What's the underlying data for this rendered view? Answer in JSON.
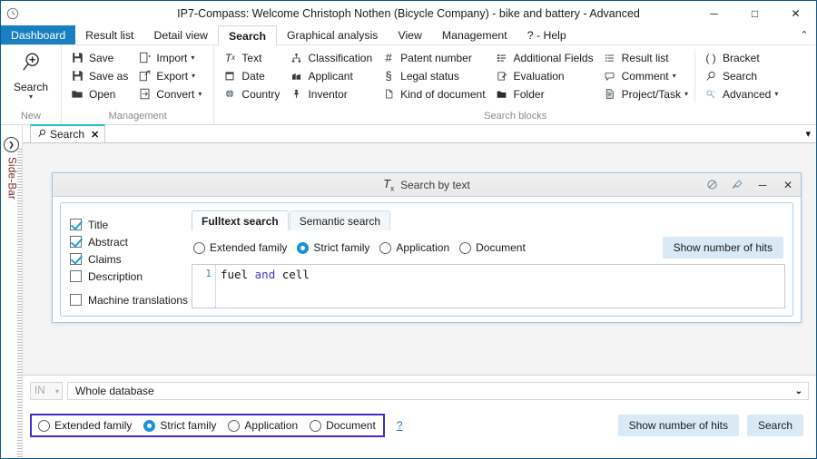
{
  "window": {
    "title": "IP7-Compass: Welcome Christoph Nothen (Bicycle Company) - bike and battery - Advanced",
    "app_icon": "clock-icon",
    "minimize": "─",
    "maximize": "□",
    "close": "✕"
  },
  "menubar": {
    "tabs": [
      {
        "label": "Dashboard",
        "state": "accent"
      },
      {
        "label": "Result list",
        "state": "normal"
      },
      {
        "label": "Detail view",
        "state": "normal"
      },
      {
        "label": "Search",
        "state": "active"
      },
      {
        "label": "Graphical analysis",
        "state": "normal"
      },
      {
        "label": "View",
        "state": "normal"
      },
      {
        "label": "Management",
        "state": "normal"
      },
      {
        "label": "? - Help",
        "state": "normal"
      }
    ],
    "collapse_icon": "chevron-up-icon",
    "collapse_glyph": "⌃"
  },
  "ribbon": {
    "groups": [
      {
        "label": "New",
        "big": {
          "label": "Search",
          "icon": "search-plus-icon",
          "glyph": "⊕",
          "caret": "▾"
        }
      },
      {
        "label": "Management",
        "columns": [
          [
            {
              "label": "Save",
              "icon": "save-icon",
              "glyph": "Ὃe",
              "caret": ""
            },
            {
              "label": "Save as",
              "icon": "save-as-icon",
              "glyph": "Ὃe",
              "caret": ""
            },
            {
              "label": "Open",
              "icon": "folder-open-icon",
              "glyph": "὜1",
              "caret": ""
            }
          ],
          [
            {
              "label": "Import",
              "icon": "import-icon",
              "glyph": "⇥",
              "caret": "▾"
            },
            {
              "label": "Export",
              "icon": "export-icon",
              "glyph": "⇤",
              "caret": "▾"
            },
            {
              "label": "Convert",
              "icon": "convert-icon",
              "glyph": "⭮",
              "caret": "▾"
            }
          ]
        ]
      },
      {
        "label": "Search blocks",
        "columns": [
          [
            {
              "label": "Text",
              "icon": "text-icon",
              "glyph": "Tₓ",
              "caret": ""
            },
            {
              "label": "Date",
              "icon": "calendar-icon",
              "glyph": "Ὄ5",
              "caret": ""
            },
            {
              "label": "Country",
              "icon": "globe-icon",
              "glyph": "ἱ0",
              "caret": ""
            }
          ],
          [
            {
              "label": "Classification",
              "icon": "hierarchy-icon",
              "glyph": "⑂",
              "caret": ""
            },
            {
              "label": "Applicant",
              "icon": "building-icon",
              "glyph": "Ἶ2",
              "caret": ""
            },
            {
              "label": "Inventor",
              "icon": "person-icon",
              "glyph": "὆4",
              "caret": ""
            }
          ],
          [
            {
              "label": "Patent number",
              "icon": "hash-icon",
              "glyph": "#",
              "caret": ""
            },
            {
              "label": "Legal status",
              "icon": "section-sign-icon",
              "glyph": "§",
              "caret": ""
            },
            {
              "label": "Kind of document",
              "icon": "document-icon",
              "glyph": "὜b",
              "caret": ""
            }
          ],
          [
            {
              "label": "Additional Fields",
              "icon": "fields-icon",
              "glyph": "☰",
              "caret": ""
            },
            {
              "label": "Evaluation",
              "icon": "evaluation-icon",
              "glyph": "✎",
              "caret": ""
            },
            {
              "label": "Folder",
              "icon": "folder-icon",
              "glyph": "Ὄ1",
              "caret": ""
            }
          ],
          [
            {
              "label": "Result list",
              "icon": "list-icon",
              "glyph": "≡",
              "caret": ""
            },
            {
              "label": "Comment",
              "icon": "comment-icon",
              "glyph": "὞a",
              "caret": "▾"
            },
            {
              "label": "Project/Task",
              "icon": "project-icon",
              "glyph": "Ὕ2",
              "caret": "▾"
            }
          ],
          [
            {
              "label": "Bracket",
              "icon": "bracket-icon",
              "glyph": "( )",
              "caret": ""
            },
            {
              "label": "Search",
              "icon": "search-icon",
              "glyph": "ὐd",
              "caret": ""
            },
            {
              "label": "Advanced",
              "icon": "advanced-icon",
              "glyph": "⚙",
              "caret": "▾"
            }
          ]
        ]
      }
    ]
  },
  "sidebar": {
    "label": "Side-Bar",
    "toggle_icon": "chevron-right-circle-icon",
    "toggle_glyph": "❯"
  },
  "doc_tabs": {
    "items": [
      {
        "label": "Search",
        "icon": "search-icon",
        "glyph": "ὐd",
        "close": "✕"
      }
    ],
    "overflow_icon": "chevron-down-icon",
    "overflow_glyph": "▾"
  },
  "dialog": {
    "title": "Search by text",
    "title_icon": "text-block-icon",
    "title_glyph": "Tₓ",
    "buttons": [
      {
        "name": "disable-block-button",
        "glyph": "⊘"
      },
      {
        "name": "clear-block-button",
        "glyph": "ᾟ9"
      },
      {
        "name": "minimize-block-button",
        "glyph": "─"
      },
      {
        "name": "close-block-button",
        "glyph": "✕"
      }
    ],
    "checkboxes": [
      {
        "label": "Title",
        "checked": true
      },
      {
        "label": "Abstract",
        "checked": true
      },
      {
        "label": "Claims",
        "checked": true
      },
      {
        "label": "Description",
        "checked": false
      },
      {
        "label": "Machine translations",
        "checked": false
      }
    ],
    "tabs": [
      {
        "label": "Fulltext search",
        "active": true
      },
      {
        "label": "Semantic search",
        "active": false
      }
    ],
    "scope_radios": [
      {
        "label": "Extended family",
        "selected": false
      },
      {
        "label": "Strict family",
        "selected": true
      },
      {
        "label": "Application",
        "selected": false
      },
      {
        "label": "Document",
        "selected": false
      }
    ],
    "show_hits_label": "Show number of hits",
    "query": {
      "line_number": "1",
      "tokens": [
        {
          "text": "fuel",
          "type": "term"
        },
        {
          "text": " ",
          "type": "space"
        },
        {
          "text": "and",
          "type": "operator"
        },
        {
          "text": " ",
          "type": "space"
        },
        {
          "text": "cell",
          "type": "term"
        }
      ]
    }
  },
  "bottom": {
    "in_label": "IN",
    "in_caret": "▾",
    "scope_value": "Whole database",
    "scope_caret": "⌄",
    "radios": [
      {
        "label": "Extended family",
        "selected": false
      },
      {
        "label": "Strict family",
        "selected": true
      },
      {
        "label": "Application",
        "selected": false
      },
      {
        "label": "Document",
        "selected": false
      }
    ],
    "help_label": "?",
    "show_hits_label": "Show number of hits",
    "search_label": "Search",
    "highlight_color": "#3b2fc4"
  }
}
